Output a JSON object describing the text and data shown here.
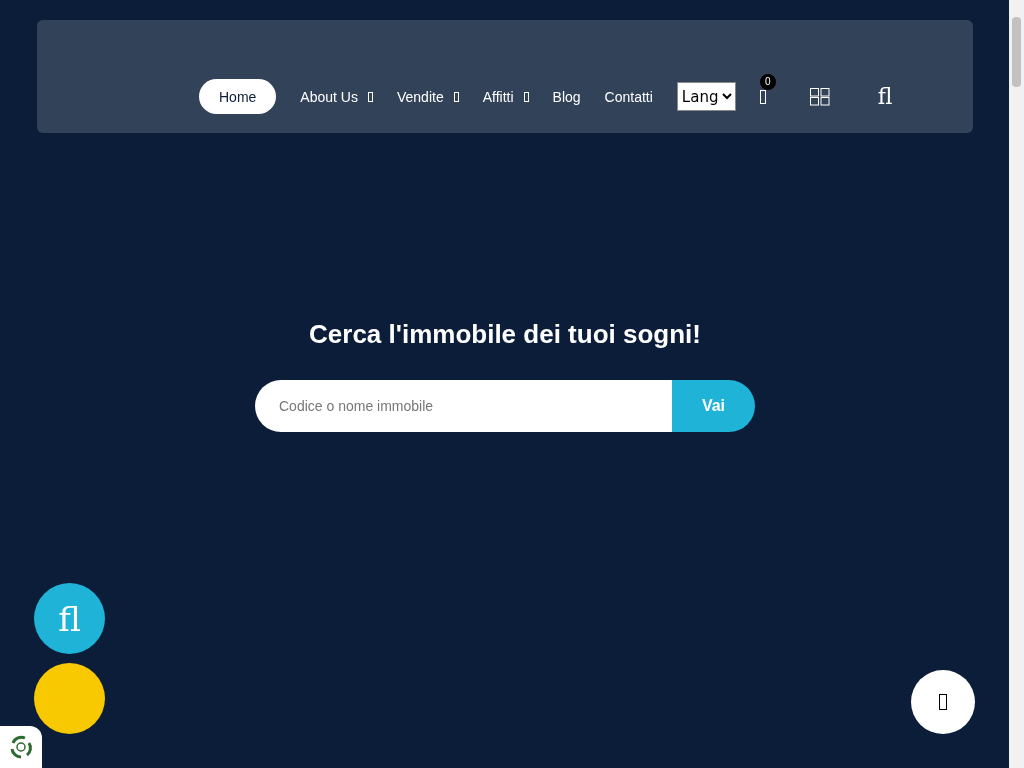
{
  "nav": {
    "items": [
      {
        "label": "Home",
        "selected": true,
        "dropdown": false
      },
      {
        "label": "About Us",
        "selected": false,
        "dropdown": true
      },
      {
        "label": "Vendite",
        "selected": false,
        "dropdown": true
      },
      {
        "label": "Affitti",
        "selected": false,
        "dropdown": true
      },
      {
        "label": "Blog",
        "selected": false,
        "dropdown": false
      },
      {
        "label": "Contatti",
        "selected": false,
        "dropdown": false
      }
    ],
    "language_select": {
      "value": "Lang"
    },
    "cart_count": "0",
    "search_glyph": "fl"
  },
  "hero": {
    "title": "Cerca l'immobile dei tuoi sogni!",
    "search": {
      "placeholder": "Codice o nome immobile",
      "button": "Vai"
    }
  },
  "floating": {
    "top_glyph": "fl"
  }
}
